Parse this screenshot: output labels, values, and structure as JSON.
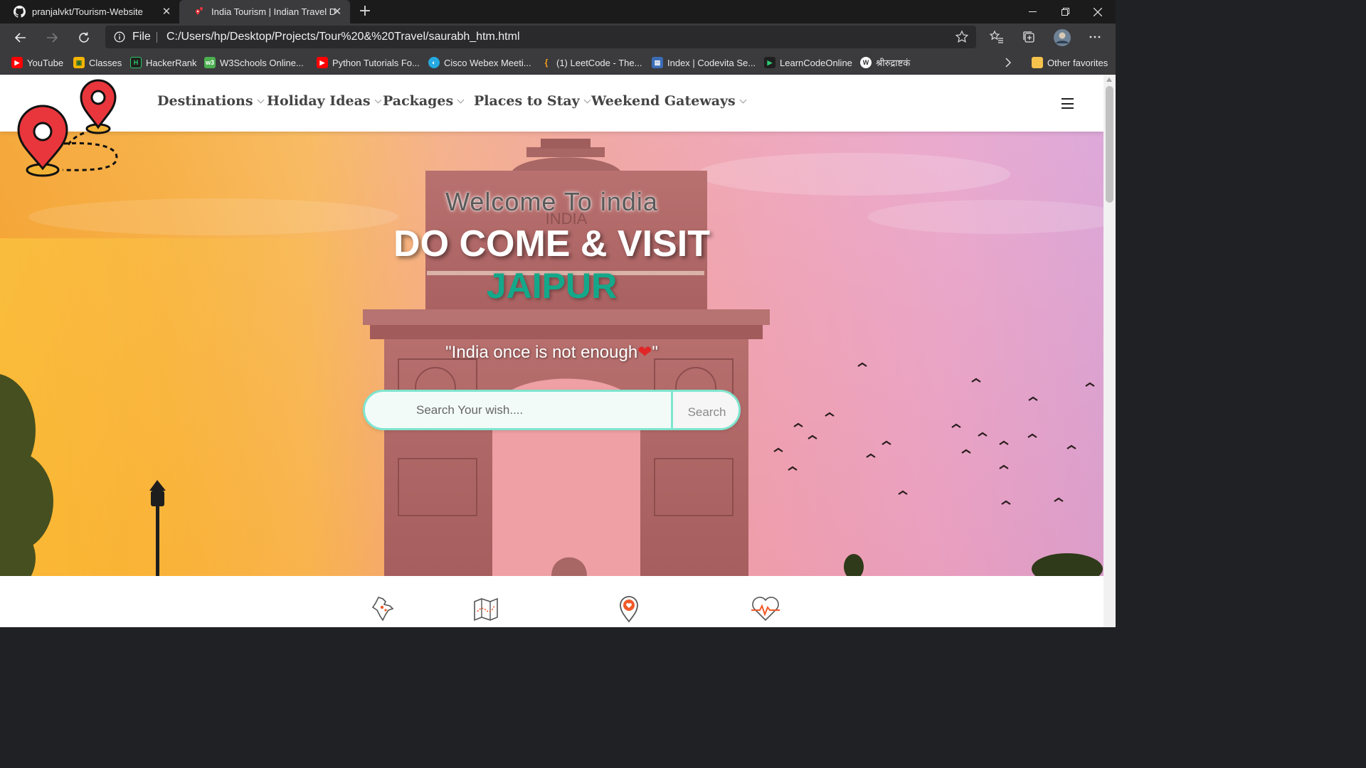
{
  "browser": {
    "tabs": [
      {
        "title": "pranjalvkt/Tourism-Website",
        "icon": "github-icon"
      },
      {
        "title": "India Tourism | Indian Travel Dest",
        "icon": "map-pin-icon",
        "active": true
      }
    ],
    "address": {
      "scheme_label": "File",
      "url": "C:/Users/hp/Desktop/Projects/Tour%20&%20Travel/saurabh_htm.html"
    },
    "bookmarks": [
      {
        "label": "YouTube",
        "icon": "youtube-icon",
        "color": "#ff0000"
      },
      {
        "label": "Classes",
        "icon": "classroom-icon",
        "color": "#f4b400"
      },
      {
        "label": "HackerRank",
        "icon": "hackerrank-icon",
        "color": "#1f1f1f"
      },
      {
        "label": "W3Schools Online...",
        "icon": "w3schools-icon",
        "color": "#4caf50"
      },
      {
        "label": "Python Tutorials Fo...",
        "icon": "youtube-icon",
        "color": "#ff0000"
      },
      {
        "label": "Cisco Webex Meeti...",
        "icon": "webex-icon",
        "color": "#26a9e0"
      },
      {
        "label": "(1) LeetCode - The...",
        "icon": "leetcode-icon",
        "color": "#f89f1b"
      },
      {
        "label": "Index | Codevita Se...",
        "icon": "codevita-icon",
        "color": "#3b6cb7"
      },
      {
        "label": "LearnCodeOnline",
        "icon": "learncodeonline-icon",
        "color": "#2ecc71"
      },
      {
        "label": "श्रीरुद्राष्टकं",
        "icon": "wordpress-icon",
        "color": "#ffffff"
      }
    ],
    "other_favorites": "Other favorites"
  },
  "nav": {
    "items": [
      {
        "label": "Destinations"
      },
      {
        "label": "Holiday Ideas"
      },
      {
        "label": "Packages"
      },
      {
        "label": "Places to Stay"
      },
      {
        "label": "Weekend Gateways"
      }
    ]
  },
  "hero": {
    "welcome": "Welcome To india",
    "title": "DO COME & VISIT",
    "city": "JAIPUR",
    "quote_text": "\"India once is not enough",
    "quote_end": "\"",
    "monument_inscription": "INDIA"
  },
  "search": {
    "placeholder": "Search Your wish....",
    "button": "Search"
  },
  "features": [
    {
      "icon": "india-map-icon"
    },
    {
      "icon": "folded-map-icon"
    },
    {
      "icon": "location-heart-icon"
    },
    {
      "icon": "heartbeat-icon"
    }
  ],
  "colors": {
    "accent_teal": "#14a88a",
    "search_border": "#7fe5cf",
    "logo_red": "#e8363c",
    "feature_orange": "#f05a28"
  }
}
